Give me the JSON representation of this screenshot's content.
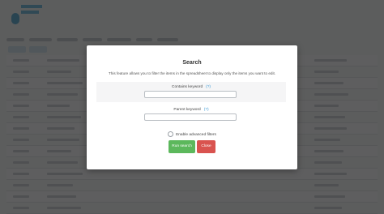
{
  "modal": {
    "title": "Search",
    "description": "This feature allows you to filter the items in the spreadsheet to display only the items you want to edit.",
    "contains_keyword_label": "Contains keyword",
    "parent_keyword_label": "Parent keyword",
    "help_text": "(?)",
    "contains_keyword_value": "",
    "parent_keyword_value": "",
    "advanced_filters_label": "Enable advanced filters",
    "run_button_label": "Run search",
    "close_button_label": "Close"
  },
  "colors": {
    "run_button": "#5cb85c",
    "close_button": "#d9534f",
    "help_link": "#3c9ad6"
  }
}
